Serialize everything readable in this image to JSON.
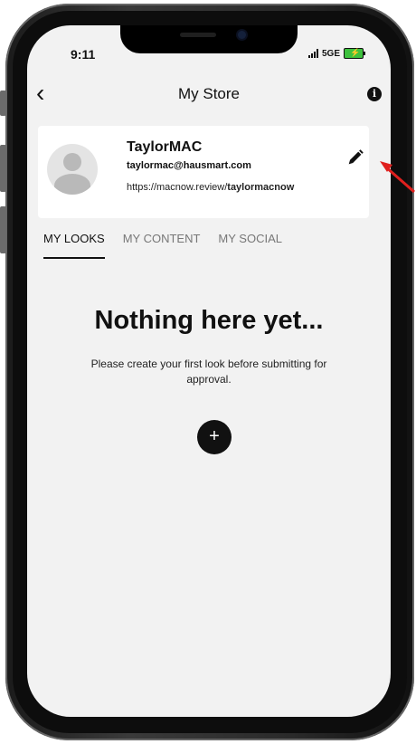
{
  "status_bar": {
    "time": "9:11",
    "network": "5GE"
  },
  "nav": {
    "title": "My Store",
    "back_icon": "chevron-left-icon",
    "info_icon": "info-icon",
    "info_glyph": "i"
  },
  "profile": {
    "name": "TaylorMAC",
    "email": "taylormac@hausmart.com",
    "url_prefix": "https://macnow.review/",
    "url_handle": "taylormacnow",
    "edit_icon": "pencil-icon"
  },
  "tabs": [
    {
      "label": "MY LOOKS",
      "active": true
    },
    {
      "label": "MY CONTENT",
      "active": false
    },
    {
      "label": "MY SOCIAL",
      "active": false
    }
  ],
  "empty_state": {
    "title": "Nothing here yet...",
    "message": "Please create your first look before submitting for approval.",
    "add_glyph": "+"
  },
  "colors": {
    "annotation": "#e0201e",
    "background": "#f2f2f2",
    "battery": "#3ec13e"
  }
}
